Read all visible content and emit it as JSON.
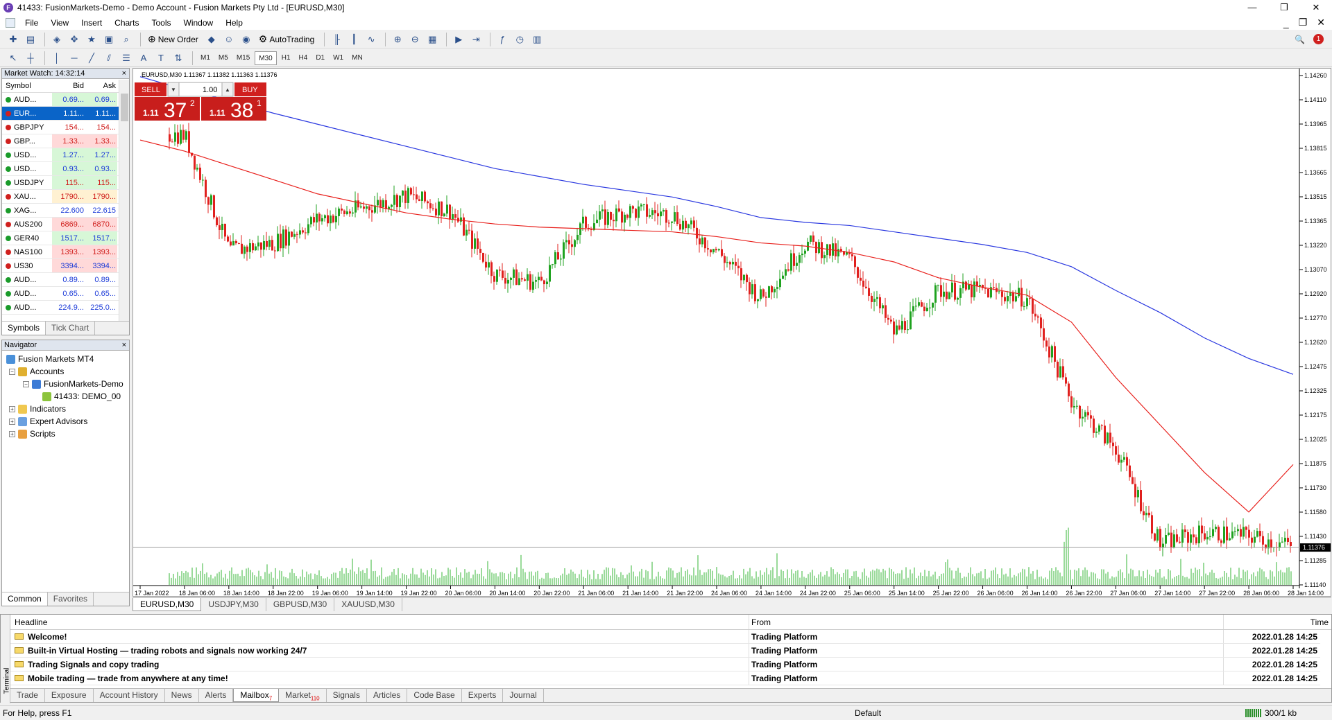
{
  "window": {
    "title": "41433: FusionMarkets-Demo - Demo Account - Fusion Markets Pty Ltd - [EURUSD,M30]",
    "logo_letter": "F",
    "minimize": "—",
    "restore": "❐",
    "close": "✕"
  },
  "menu": [
    "File",
    "View",
    "Insert",
    "Charts",
    "Tools",
    "Window",
    "Help"
  ],
  "mdi": {
    "minimize": "_",
    "restore": "❐",
    "close": "✕",
    "search_icon": "🔍",
    "notify_count": "1"
  },
  "toolbar": {
    "new_order": "New Order",
    "auto_trading": "AutoTrading"
  },
  "timeframes": [
    "M1",
    "M5",
    "M15",
    "M30",
    "H1",
    "H4",
    "D1",
    "W1",
    "MN"
  ],
  "active_timeframe": "M30",
  "market_watch": {
    "title": "Market Watch: 14:32:14",
    "headers": {
      "symbol": "Symbol",
      "bid": "Bid",
      "ask": "Ask"
    },
    "rows": [
      {
        "symbol": "AUD...",
        "bid": "0.69...",
        "ask": "0.69...",
        "dir": "up",
        "bg": "#d7f7d7",
        "color": "#1b3ad8"
      },
      {
        "symbol": "EUR...",
        "bid": "1.11...",
        "ask": "1.11...",
        "dir": "down",
        "bg": "#0a64c8",
        "color": "#ffffff",
        "selected": true
      },
      {
        "symbol": "GBPJPY",
        "bid": "154...",
        "ask": "154...",
        "dir": "down",
        "bg": "#ffffff",
        "color": "#d0201e"
      },
      {
        "symbol": "GBP...",
        "bid": "1.33...",
        "ask": "1.33...",
        "dir": "down",
        "bg": "#ffd9d9",
        "color": "#d0201e"
      },
      {
        "symbol": "USD...",
        "bid": "1.27...",
        "ask": "1.27...",
        "dir": "up",
        "bg": "#d7f7d7",
        "color": "#1b3ad8"
      },
      {
        "symbol": "USD...",
        "bid": "0.93...",
        "ask": "0.93...",
        "dir": "up",
        "bg": "#d7f7d7",
        "color": "#1b3ad8"
      },
      {
        "symbol": "USDJPY",
        "bid": "115...",
        "ask": "115...",
        "dir": "up",
        "bg": "#d7f7d7",
        "color": "#d0201e"
      },
      {
        "symbol": "XAU...",
        "bid": "1790...",
        "ask": "1790...",
        "dir": "down",
        "bg": "#fff1d2",
        "color": "#d0201e"
      },
      {
        "symbol": "XAG...",
        "bid": "22.600",
        "ask": "22.615",
        "dir": "up",
        "bg": "#ffffff",
        "color": "#1b3ad8"
      },
      {
        "symbol": "AUS200",
        "bid": "6869...",
        "ask": "6870...",
        "dir": "down",
        "bg": "#ffd9d9",
        "color": "#d0201e"
      },
      {
        "symbol": "GER40",
        "bid": "1517...",
        "ask": "1517...",
        "dir": "up",
        "bg": "#d7f7d7",
        "color": "#1b3ad8"
      },
      {
        "symbol": "NAS100",
        "bid": "1393...",
        "ask": "1393...",
        "dir": "down",
        "bg": "#ffd9d9",
        "color": "#d0201e"
      },
      {
        "symbol": "US30",
        "bid": "3394...",
        "ask": "3394...",
        "dir": "down",
        "bg": "#ffd9d9",
        "color": "#1b3ad8"
      },
      {
        "symbol": "AUD...",
        "bid": "0.89...",
        "ask": "0.89...",
        "dir": "up",
        "bg": "#ffffff",
        "color": "#1b3ad8"
      },
      {
        "symbol": "AUD...",
        "bid": "0.65...",
        "ask": "0.65...",
        "dir": "up",
        "bg": "#ffffff",
        "color": "#1b3ad8"
      },
      {
        "symbol": "AUD...",
        "bid": "224.9...",
        "ask": "225.0...",
        "dir": "up",
        "bg": "#ffffff",
        "color": "#1b3ad8"
      }
    ],
    "tabs": [
      "Symbols",
      "Tick Chart"
    ]
  },
  "navigator": {
    "title": "Navigator",
    "root": "Fusion Markets MT4",
    "accounts": "Accounts",
    "server": "FusionMarkets-Demo",
    "account": "41433: DEMO_00",
    "indicators": "Indicators",
    "experts": "Expert Advisors",
    "scripts": "Scripts",
    "tabs": [
      "Common",
      "Favorites"
    ]
  },
  "chart": {
    "info": "EURUSD,M30  1.11367 1.11382 1.11363 1.11376",
    "trade": {
      "sell": "SELL",
      "buy": "BUY",
      "lot": "1.00",
      "sell_prefix": "1.11",
      "sell_big": "37",
      "sell_sup": "2",
      "buy_prefix": "1.11",
      "buy_big": "38",
      "buy_sup": "1"
    },
    "current_price": "1.11376",
    "price_ticks": [
      "1.14260",
      "1.14110",
      "1.13965",
      "1.13815",
      "1.13665",
      "1.13515",
      "1.13365",
      "1.13220",
      "1.13070",
      "1.12920",
      "1.12770",
      "1.12620",
      "1.12475",
      "1.12325",
      "1.12175",
      "1.12025",
      "1.11875",
      "1.11730",
      "1.11580",
      "1.11430",
      "1.11285",
      "1.11140"
    ],
    "time_ticks": [
      "17 Jan 2022",
      "18 Jan 06:00",
      "18 Jan 14:00",
      "18 Jan 22:00",
      "19 Jan 06:00",
      "19 Jan 14:00",
      "19 Jan 22:00",
      "20 Jan 06:00",
      "20 Jan 14:00",
      "20 Jan 22:00",
      "21 Jan 06:00",
      "21 Jan 14:00",
      "21 Jan 22:00",
      "24 Jan 06:00",
      "24 Jan 14:00",
      "24 Jan 22:00",
      "25 Jan 06:00",
      "25 Jan 14:00",
      "25 Jan 22:00",
      "26 Jan 06:00",
      "26 Jan 14:00",
      "26 Jan 22:00",
      "27 Jan 06:00",
      "27 Jan 14:00",
      "27 Jan 22:00",
      "28 Jan 06:00",
      "28 Jan 14:00"
    ],
    "colors": {
      "bull": "#1fa21f",
      "bear": "#e0201e",
      "ma_fast": "#e8201c",
      "ma_slow": "#2a38e0",
      "volume": "#35b535"
    }
  },
  "chart_data": {
    "type": "line",
    "title": "EURUSD,M30",
    "ylim": [
      1.1114,
      1.1434
    ],
    "x": [
      "17 Jan 2022",
      "18 Jan 06:00",
      "18 Jan 14:00",
      "18 Jan 22:00",
      "19 Jan 06:00",
      "19 Jan 14:00",
      "19 Jan 22:00",
      "20 Jan 06:00",
      "20 Jan 14:00",
      "20 Jan 22:00",
      "21 Jan 06:00",
      "21 Jan 14:00",
      "21 Jan 22:00",
      "24 Jan 06:00",
      "24 Jan 14:00",
      "24 Jan 22:00",
      "25 Jan 06:00",
      "25 Jan 14:00",
      "25 Jan 22:00",
      "26 Jan 06:00",
      "26 Jan 14:00",
      "26 Jan 22:00",
      "27 Jan 06:00",
      "27 Jan 14:00",
      "27 Jan 22:00",
      "28 Jan 06:00",
      "28 Jan 14:00"
    ],
    "series": [
      {
        "name": "",
        "values": [
          1.14,
          1.1398,
          1.1325,
          1.133,
          1.1345,
          1.1352,
          1.136,
          1.135,
          1.131,
          1.1305,
          1.1342,
          1.135,
          1.1348,
          1.1325,
          1.1295,
          1.133,
          1.132,
          1.1273,
          1.13,
          1.13,
          1.1295,
          1.123,
          1.12,
          1.114,
          1.1147,
          1.1145,
          1.1138
        ]
      },
      {
        "name": "",
        "values": [
          1.1395,
          1.1388,
          1.1379,
          1.137,
          1.1361,
          1.1355,
          1.1349,
          1.1345,
          1.1342,
          1.134,
          1.1339,
          1.1338,
          1.1337,
          1.1334,
          1.133,
          1.1328,
          1.1324,
          1.1318,
          1.1308,
          1.1302,
          1.1297,
          1.128,
          1.1245,
          1.1215,
          1.1185,
          1.116,
          1.119
        ]
      },
      {
        "name": "",
        "values": [
          1.1435,
          1.1427,
          1.142,
          1.1412,
          1.1405,
          1.1398,
          1.1391,
          1.1384,
          1.1377,
          1.1372,
          1.1367,
          1.1363,
          1.1359,
          1.1353,
          1.1346,
          1.1343,
          1.1341,
          1.1337,
          1.1333,
          1.1329,
          1.1324,
          1.1315,
          1.13,
          1.1286,
          1.127,
          1.1257,
          1.1247
        ]
      }
    ]
  },
  "chart_tabs": [
    "EURUSD,M30",
    "USDJPY,M30",
    "GBPUSD,M30",
    "XAUUSD,M30"
  ],
  "terminal": {
    "side_label": "Terminal",
    "headers": {
      "headline": "Headline",
      "from": "From",
      "time": "Time"
    },
    "rows": [
      {
        "headline": "Welcome!",
        "from": "Trading Platform",
        "time": "2022.01.28 14:25"
      },
      {
        "headline": "Built-in Virtual Hosting — trading robots and signals now working 24/7",
        "from": "Trading Platform",
        "time": "2022.01.28 14:25"
      },
      {
        "headline": "Trading Signals and copy trading",
        "from": "Trading Platform",
        "time": "2022.01.28 14:25"
      },
      {
        "headline": "Mobile trading — trade from anywhere at any time!",
        "from": "Trading Platform",
        "time": "2022.01.28 14:25"
      }
    ],
    "tabs": [
      {
        "label": "Trade"
      },
      {
        "label": "Exposure"
      },
      {
        "label": "Account History"
      },
      {
        "label": "News"
      },
      {
        "label": "Alerts"
      },
      {
        "label": "Mailbox",
        "badge": "7",
        "active": true
      },
      {
        "label": "Market",
        "badge": "110"
      },
      {
        "label": "Signals"
      },
      {
        "label": "Articles"
      },
      {
        "label": "Code Base"
      },
      {
        "label": "Experts"
      },
      {
        "label": "Journal"
      }
    ]
  },
  "status": {
    "help": "For Help, press F1",
    "profile": "Default",
    "traffic": "300/1 kb"
  }
}
